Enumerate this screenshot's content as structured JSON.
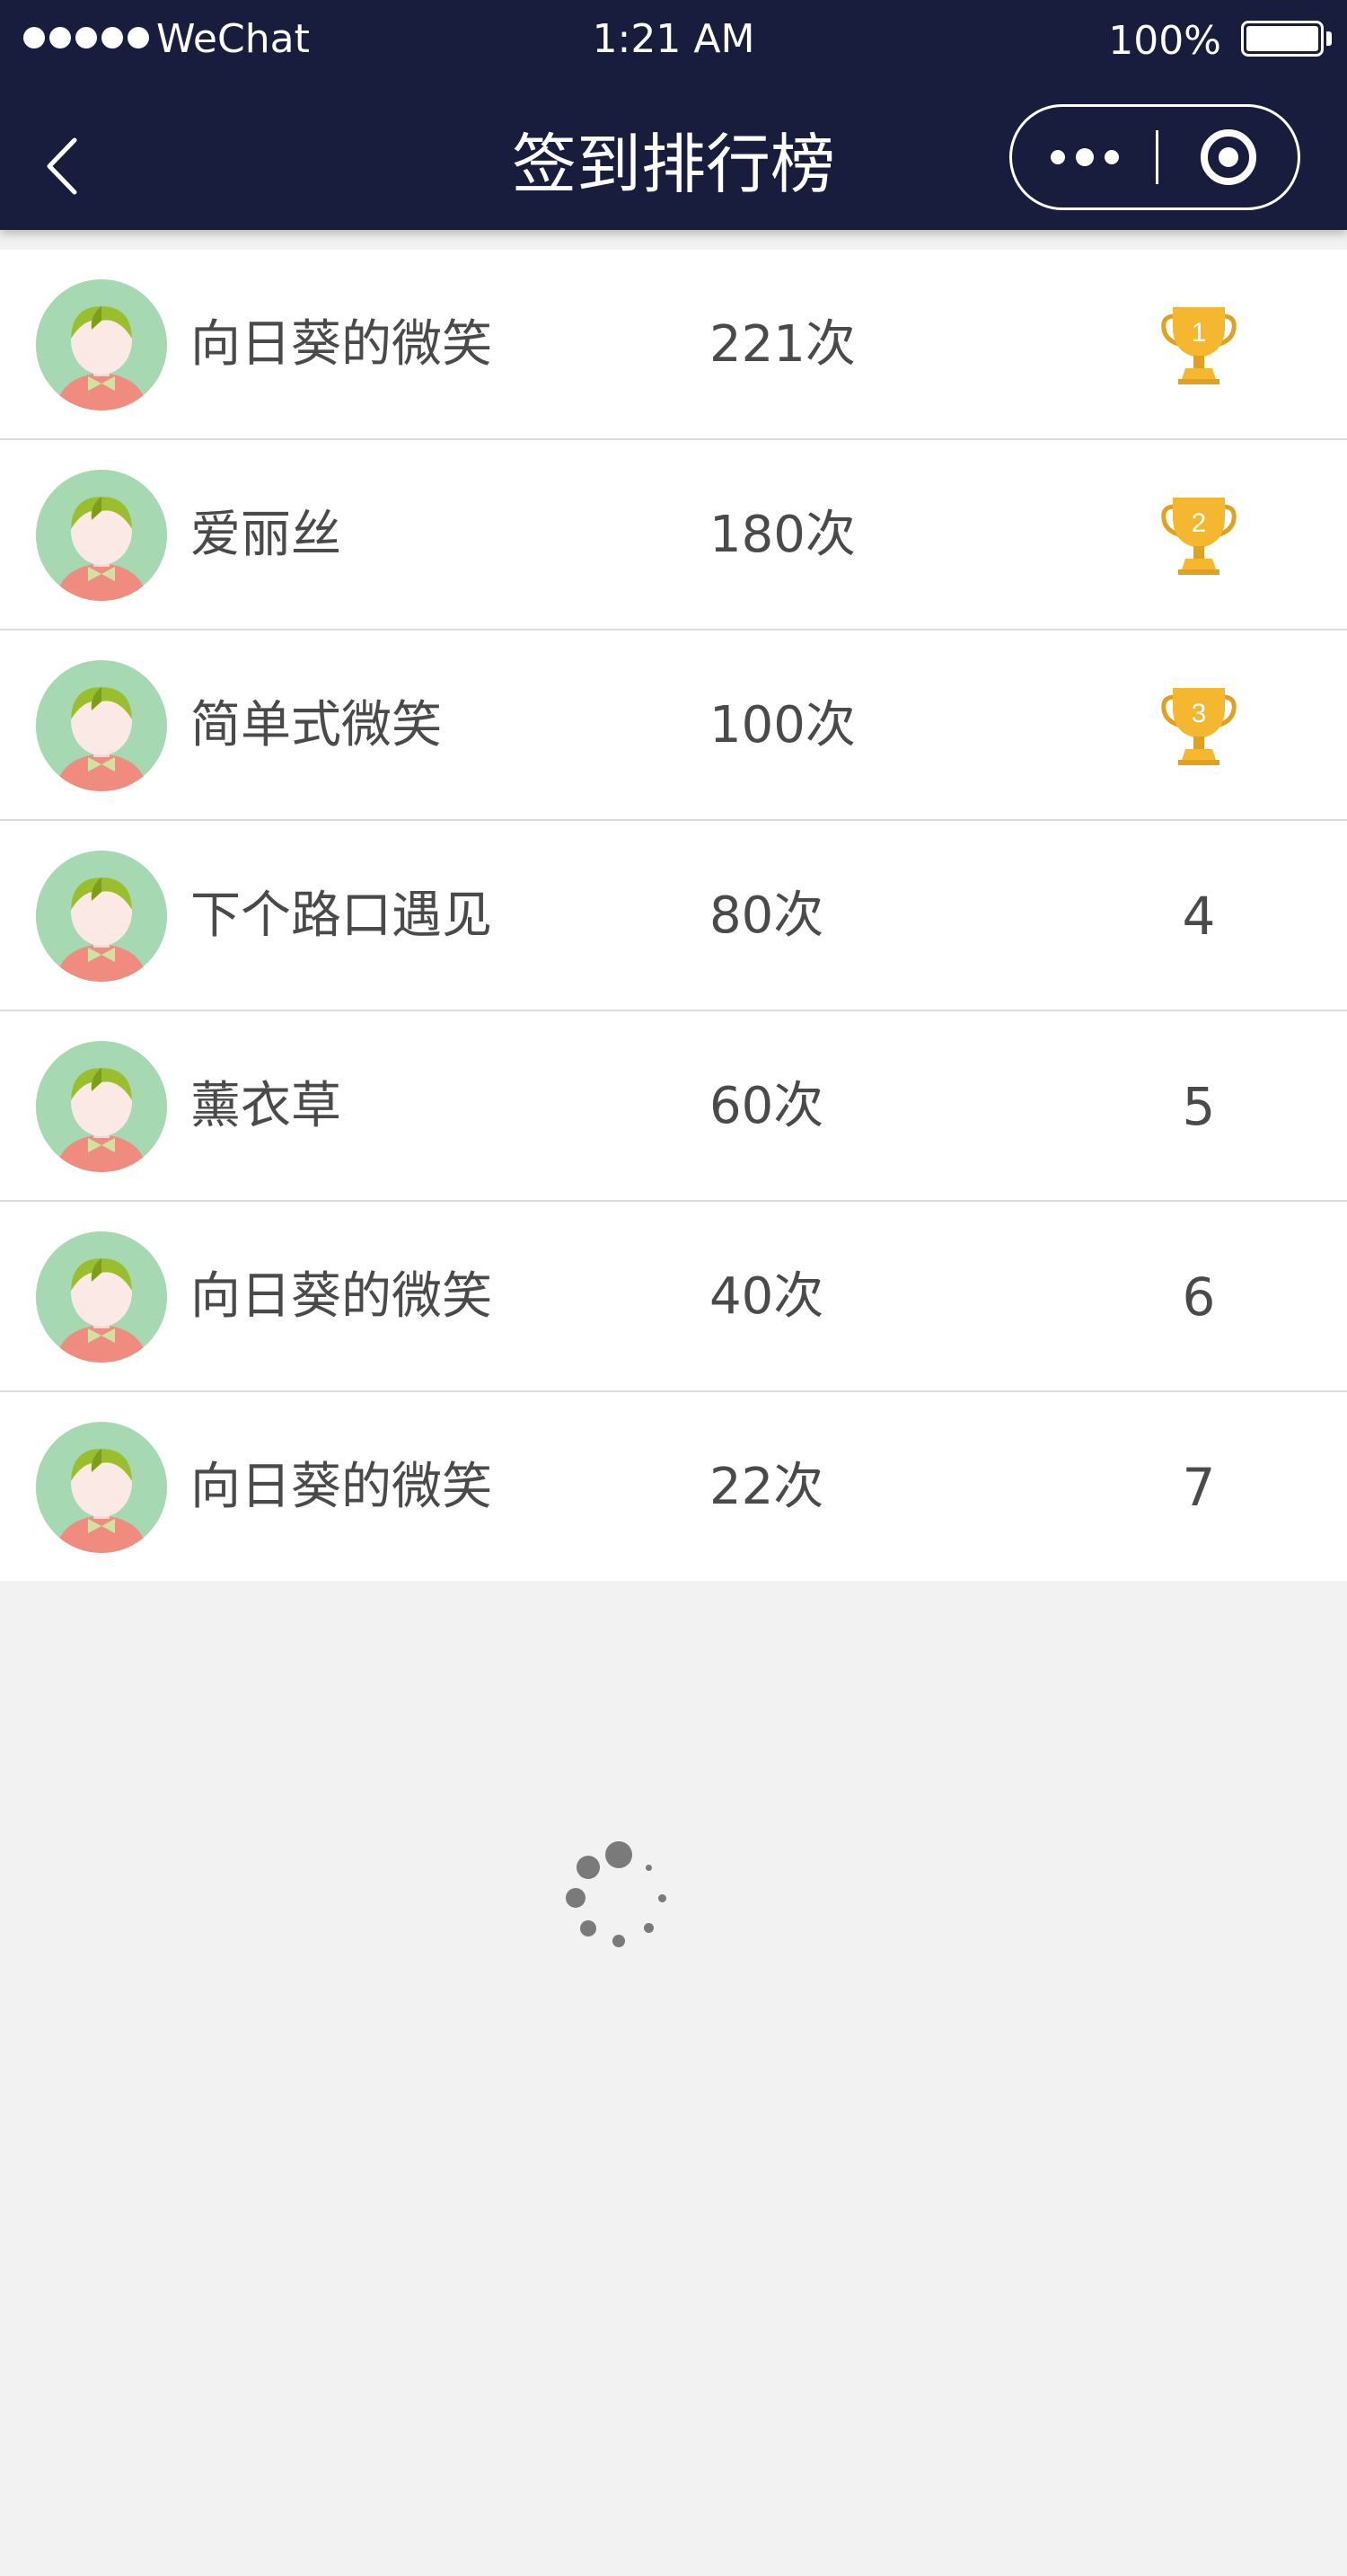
{
  "status_bar": {
    "carrier": "WeChat",
    "time": "1:21 AM",
    "battery": "100%"
  },
  "header": {
    "title": "签到排行榜",
    "back_icon": "chevron-left-icon",
    "more_icon": "more-dots-icon",
    "close_icon": "target-close-icon"
  },
  "colors": {
    "header_bg": "#181d3e",
    "page_bg": "#f2f2f2",
    "text": "#4a4a4a",
    "trophy_gold": "#f5b730",
    "avatar_bg": "#a6d8b2"
  },
  "rankings": [
    {
      "name": "向日葵的微笑",
      "count": "221次",
      "rank": "1",
      "trophy": true
    },
    {
      "name": "爱丽丝",
      "count": "180次",
      "rank": "2",
      "trophy": true
    },
    {
      "name": "简单式微笑",
      "count": "100次",
      "rank": "3",
      "trophy": true
    },
    {
      "name": "下个路口遇见",
      "count": "80次",
      "rank": "4",
      "trophy": false
    },
    {
      "name": "薰衣草",
      "count": "60次",
      "rank": "5",
      "trophy": false
    },
    {
      "name": "向日葵的微笑",
      "count": "40次",
      "rank": "6",
      "trophy": false
    },
    {
      "name": "向日葵的微笑",
      "count": "22次",
      "rank": "7",
      "trophy": false
    }
  ],
  "loading_icon": "loading-spinner-icon"
}
